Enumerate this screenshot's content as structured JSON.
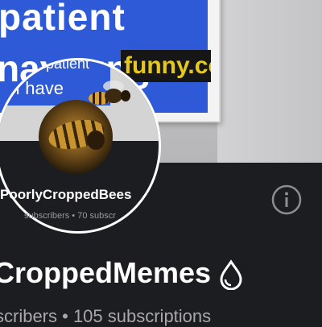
{
  "banner": {
    "line1": "patient",
    "line2": "nayoung",
    "watermark": "funny.co"
  },
  "inset": {
    "text1": "patient",
    "text2": "I have",
    "channel_name": "PoorlyCroppedBees",
    "stats": "subscribers • 70 subscr"
  },
  "profile": {
    "title": "CroppedMemes",
    "subs": "scribers • 105 subscriptions"
  },
  "icons": {
    "info": "info-icon",
    "verified": "verified-drop-icon",
    "avatar": "bee-avatar"
  },
  "colors": {
    "background": "#1c1d20",
    "banner_blue": "#2e5ad8",
    "watermark_yellow": "#e6c81d",
    "text": "#ffffff",
    "muted": "#a8a8a8"
  }
}
